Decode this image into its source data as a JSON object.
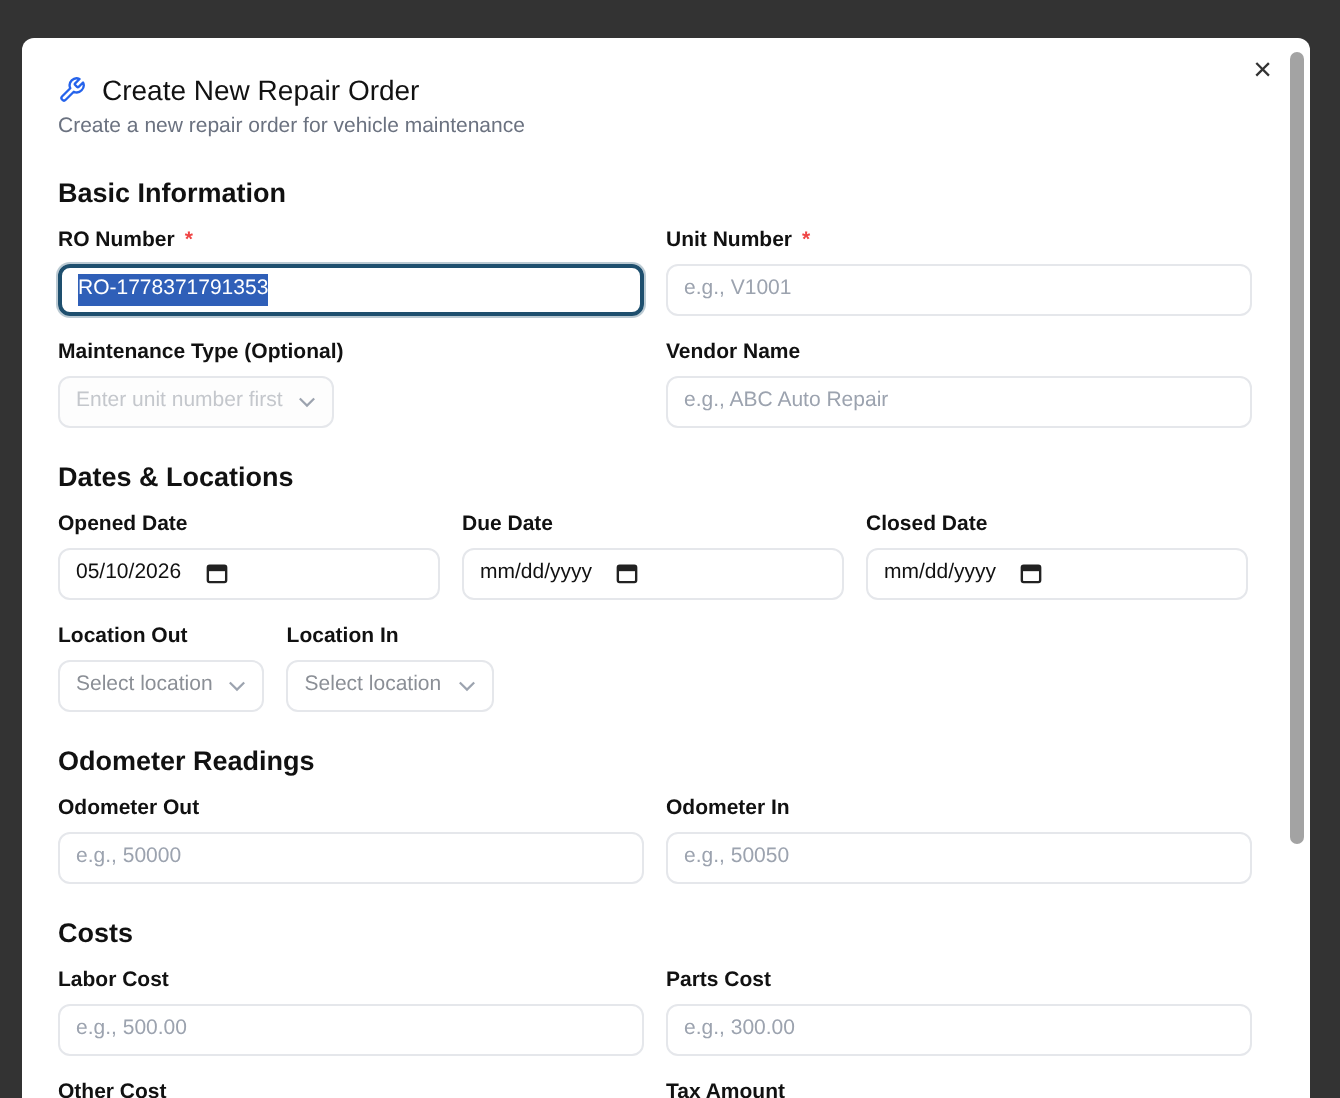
{
  "dialog": {
    "title": "Create New Repair Order",
    "subtitle": "Create a new repair order for vehicle maintenance",
    "close": "×"
  },
  "sections": [
    {
      "heading": "Basic Information",
      "rows": [
        [
          {
            "kind": "text",
            "label": "RO Number",
            "required_mark": "*",
            "value": "RO-1778371791353",
            "focused": true
          },
          {
            "kind": "text",
            "label": "Unit Number",
            "required_mark": "*",
            "placeholder": "e.g., V1001",
            "focused": false
          }
        ],
        [
          {
            "kind": "select",
            "label": "Maintenance Type (Optional)",
            "placeholder": "Enter unit number first",
            "disabled": true
          },
          {
            "kind": "text",
            "label": "Vendor Name",
            "placeholder": "e.g., ABC Auto Repair",
            "focused": false
          }
        ]
      ]
    },
    {
      "heading": "Dates & Locations",
      "rows": [
        [
          {
            "kind": "date",
            "label": "Opened Date",
            "value": "05/10/2026"
          },
          {
            "kind": "date",
            "label": "Due Date",
            "placeholder": "mm/dd/yyyy"
          },
          {
            "kind": "date",
            "label": "Closed Date",
            "placeholder": "mm/dd/yyyy"
          }
        ],
        [
          {
            "kind": "select",
            "label": "Location Out",
            "placeholder": "Select location",
            "disabled": false
          },
          {
            "kind": "select",
            "label": "Location In",
            "placeholder": "Select location",
            "disabled": false
          }
        ]
      ]
    },
    {
      "heading": "Odometer Readings",
      "rows": [
        [
          {
            "kind": "text",
            "label": "Odometer Out",
            "placeholder": "e.g., 50000",
            "focused": false
          },
          {
            "kind": "text",
            "label": "Odometer In",
            "placeholder": "e.g., 50050",
            "focused": false
          }
        ]
      ]
    },
    {
      "heading": "Costs",
      "rows": [
        [
          {
            "kind": "text",
            "label": "Labor Cost",
            "placeholder": "e.g., 500.00",
            "focused": false
          },
          {
            "kind": "text",
            "label": "Parts Cost",
            "placeholder": "e.g., 300.00",
            "focused": false
          }
        ],
        [
          {
            "kind": "label",
            "label": "Other Cost"
          },
          {
            "kind": "label",
            "label": "Tax Amount"
          }
        ]
      ]
    }
  ]
}
